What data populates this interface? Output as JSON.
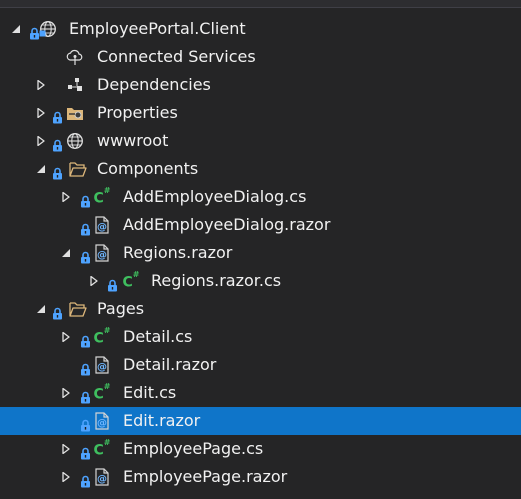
{
  "explorer": {
    "items": [
      {
        "label": "EmployeePortal.Client",
        "icon": "web-project-icon",
        "expander": "expanded"
      },
      {
        "label": "Connected Services",
        "icon": "connected-services-icon",
        "expander": "none"
      },
      {
        "label": "Dependencies",
        "icon": "dependencies-icon",
        "expander": "collapsed"
      },
      {
        "label": "Properties",
        "icon": "properties-folder-icon",
        "expander": "collapsed"
      },
      {
        "label": "wwwroot",
        "icon": "globe-icon",
        "expander": "collapsed"
      },
      {
        "label": "Components",
        "icon": "folder-open-icon",
        "expander": "expanded"
      },
      {
        "label": "AddEmployeeDialog.cs",
        "icon": "csharp-file-icon",
        "expander": "collapsed"
      },
      {
        "label": "AddEmployeeDialog.razor",
        "icon": "razor-file-icon",
        "expander": "none"
      },
      {
        "label": "Regions.razor",
        "icon": "razor-file-icon",
        "expander": "expanded"
      },
      {
        "label": "Regions.razor.cs",
        "icon": "csharp-file-icon",
        "expander": "collapsed"
      },
      {
        "label": "Pages",
        "icon": "folder-open-icon",
        "expander": "expanded"
      },
      {
        "label": "Detail.cs",
        "icon": "csharp-file-icon",
        "expander": "collapsed"
      },
      {
        "label": "Detail.razor",
        "icon": "razor-file-icon",
        "expander": "none"
      },
      {
        "label": "Edit.cs",
        "icon": "csharp-file-icon",
        "expander": "collapsed"
      },
      {
        "label": "Edit.razor",
        "icon": "razor-file-icon",
        "expander": "none",
        "selected": true
      },
      {
        "label": "EmployeePage.cs",
        "icon": "csharp-file-icon",
        "expander": "collapsed"
      },
      {
        "label": "EmployeePage.razor",
        "icon": "razor-file-icon",
        "expander": "collapsed"
      }
    ]
  },
  "colors": {
    "background": "#252526",
    "selection": "#0f75c9",
    "text": "#f1f1f1",
    "csharp_green": "#3fbf5f",
    "folder": "#dcb67a",
    "lock_blue": "#4ea3ff"
  }
}
